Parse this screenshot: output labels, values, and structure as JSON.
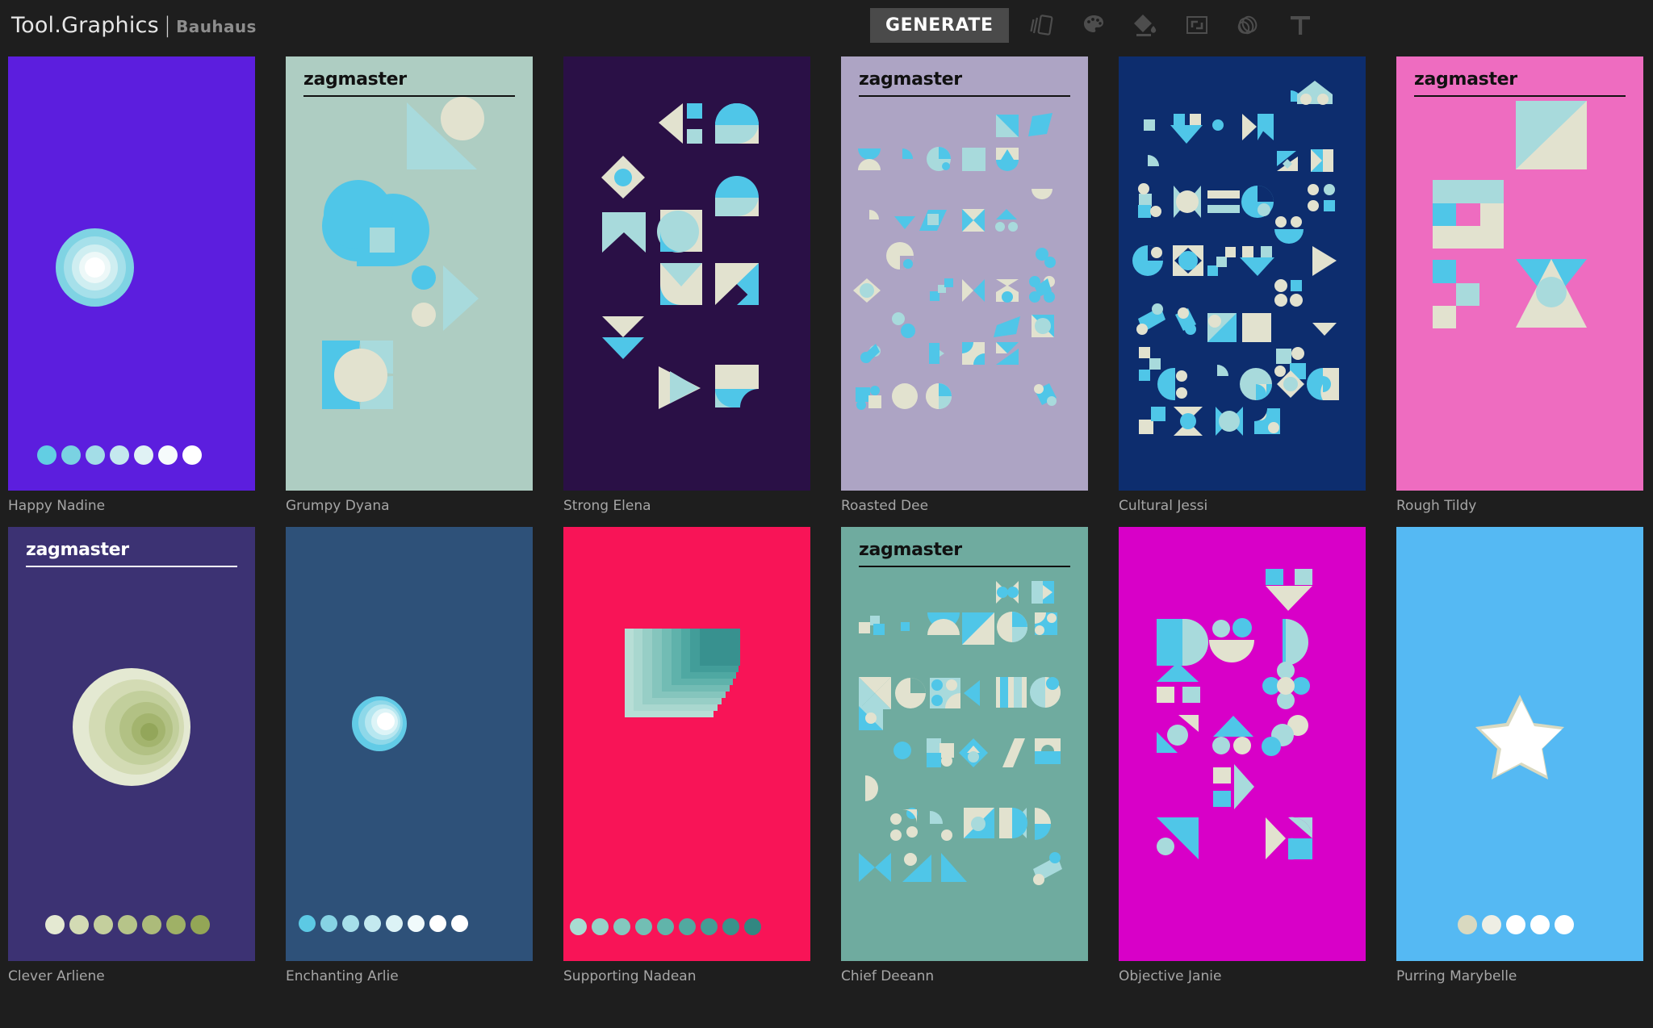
{
  "app": {
    "brand_main": "Tool.Graphics",
    "brand_separator": "|",
    "brand_sub": "Bauhaus",
    "background": "#1e1e1e"
  },
  "toolbar": {
    "generate_label": "GENERATE",
    "generate_bg": "#4a4a4a",
    "icons": [
      {
        "name": "cards-icon",
        "title": "Cards"
      },
      {
        "name": "palette-icon",
        "title": "Palette"
      },
      {
        "name": "paint-bucket-icon",
        "title": "Fill"
      },
      {
        "name": "resize-icon",
        "title": "Resize"
      },
      {
        "name": "rings-icon",
        "title": "Rings"
      },
      {
        "name": "text-icon",
        "title": "Text"
      }
    ],
    "icon_color": "#4d4d4d"
  },
  "palette": {
    "cyan": "#4fc6e8",
    "aqua": "#a8dadc",
    "cream": "#e2e2cf",
    "white": "#ffffff"
  },
  "gallery": {
    "cards": [
      {
        "id": "happy-nadine",
        "label": "Happy Nadine",
        "background": "#5c1ede",
        "title": null,
        "style": "rings",
        "dot_count": 7,
        "dot_colors": [
          "#62cee3",
          "#7ad2e2",
          "#a3dde7",
          "#c4e8ee",
          "#e0f2f4",
          "#f6fbfb",
          "#ffffff"
        ]
      },
      {
        "id": "grumpy-dyana",
        "label": "Grumpy Dyana",
        "background": "#aecdc2",
        "title": "zagmaster",
        "title_color": "#111111",
        "style": "shapes-large",
        "dot_count": 0,
        "dot_colors": []
      },
      {
        "id": "strong-elena",
        "label": "Strong Elena",
        "background": "#2a1046",
        "title": null,
        "style": "shapes-medium",
        "dot_count": 0,
        "dot_colors": []
      },
      {
        "id": "roasted-dee",
        "label": "Roasted Dee",
        "background": "#ada4c4",
        "title": "zagmaster",
        "title_color": "#111111",
        "style": "shapes-dense",
        "dot_count": 0,
        "dot_colors": []
      },
      {
        "id": "cultural-jessi",
        "label": "Cultural Jessi",
        "background": "#0d2d6e",
        "title": null,
        "style": "shapes-dense",
        "dot_count": 0,
        "dot_colors": []
      },
      {
        "id": "rough-tildy",
        "label": "Rough Tildy",
        "background": "#ee6cc0",
        "title": "zagmaster",
        "title_color": "#111111",
        "style": "shapes-xl",
        "dot_count": 0,
        "dot_colors": []
      },
      {
        "id": "clever-arliene",
        "label": "Clever Arliene",
        "background": "#3c3273",
        "title": "zagmaster",
        "title_color": "#ffffff",
        "style": "rings-offset",
        "dot_count": 7,
        "dot_colors": [
          "#e4e9d2",
          "#d3dbb4",
          "#c4cf9d",
          "#b6c489",
          "#acbb7a",
          "#9fb166",
          "#93a656"
        ]
      },
      {
        "id": "enchanting-arlie",
        "label": "Enchanting Arlie",
        "background": "#2e5179",
        "title": null,
        "style": "rings-small",
        "dot_count": 8,
        "dot_colors": [
          "#5cc9e4",
          "#86d3e3",
          "#a6dfe9",
          "#c3e9ef",
          "#dcf3f6",
          "#f0fafb",
          "#ffffff",
          "#ffffff"
        ]
      },
      {
        "id": "supporting-nadean",
        "label": "Supporting Nadean",
        "background": "#f81457",
        "title": null,
        "style": "squares-stack",
        "dot_count": 9,
        "dot_colors": [
          "#a8dcd2",
          "#96d2c8",
          "#84c8be",
          "#72beb4",
          "#61b4aa",
          "#52a9a0",
          "#459d95",
          "#3a928b",
          "#328781"
        ]
      },
      {
        "id": "chief-deeann",
        "label": "Chief Deeann",
        "background": "#6fab9f",
        "title": "zagmaster",
        "title_color": "#111111",
        "style": "shapes-dense",
        "dot_count": 0,
        "dot_colors": []
      },
      {
        "id": "objective-janie",
        "label": "Objective Janie",
        "background": "#d800c8",
        "title": null,
        "style": "shapes-medium",
        "dot_count": 0,
        "dot_colors": []
      },
      {
        "id": "purring-marybelle",
        "label": "Purring Marybelle",
        "background": "#55b9f3",
        "title": null,
        "style": "star",
        "dot_count": 5,
        "dot_colors": [
          "#d9d9c0",
          "#eeeee4",
          "#ffffff",
          "#ffffff",
          "#ffffff"
        ]
      }
    ]
  }
}
